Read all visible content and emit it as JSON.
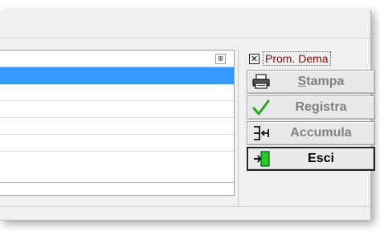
{
  "grid": {
    "expand_symbol": "⊞"
  },
  "checkbox": {
    "checked_mark": "✕",
    "label": "Prom. Dema"
  },
  "buttons": {
    "stampa": "Stampa",
    "registra": "Registra",
    "accumula": "Accumula",
    "esci": "Esci"
  },
  "colors": {
    "selection": "#3399ff",
    "checkbox_label": "#a00000",
    "check_green": "#22aa22"
  }
}
